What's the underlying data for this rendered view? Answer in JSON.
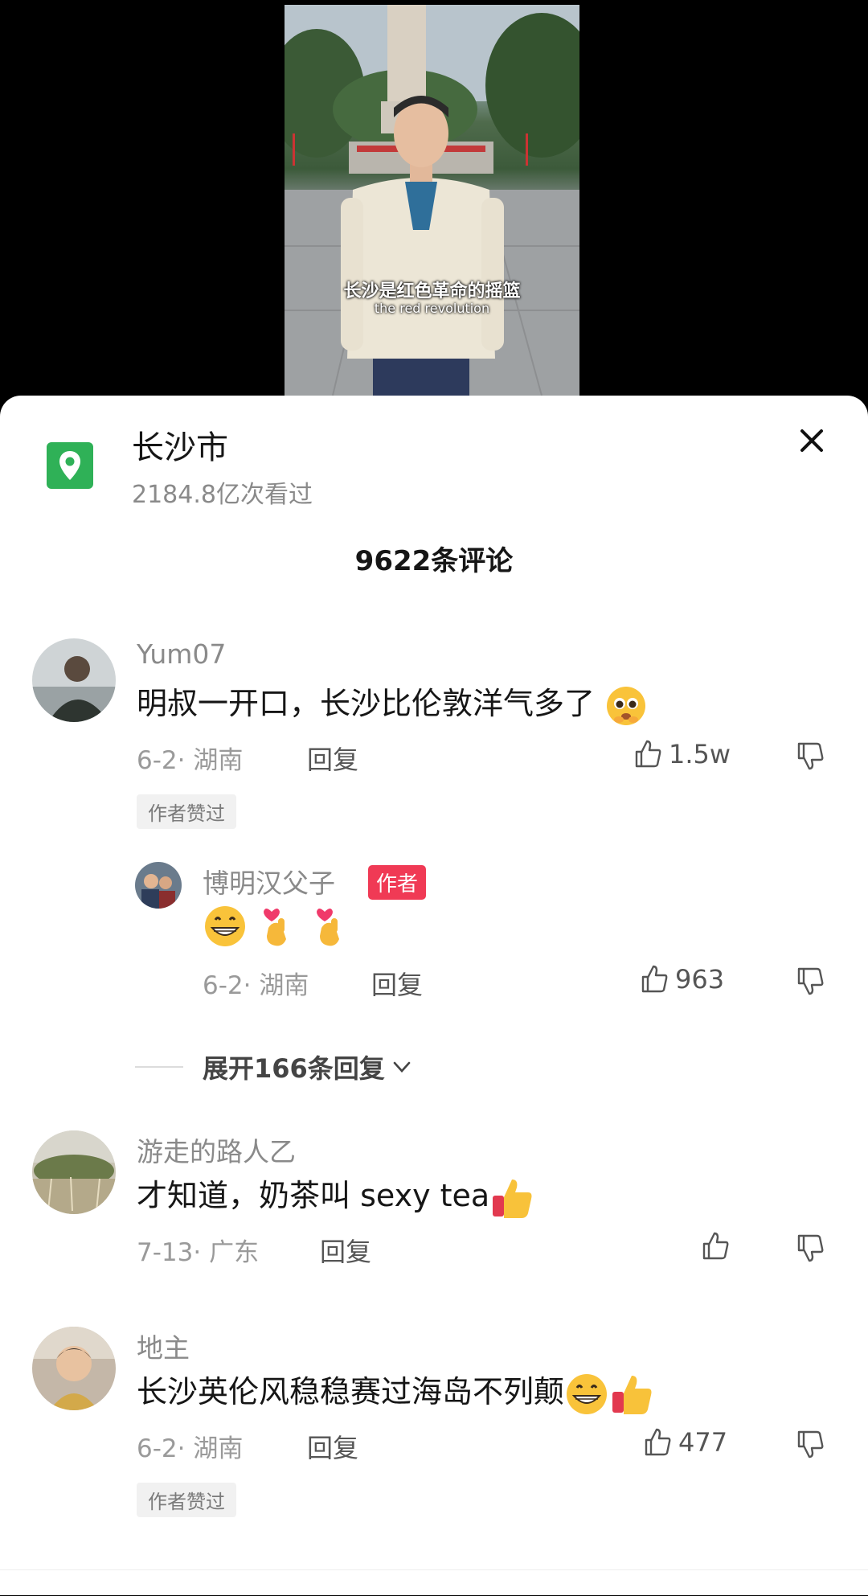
{
  "video": {
    "subtitle_cn": "长沙是红色革命的摇篮",
    "subtitle_en": "the red revolution"
  },
  "location": {
    "icon": "location-pin-icon",
    "title": "长沙市",
    "views": "2184.8亿次看过",
    "accent": "#2fb157"
  },
  "header": {
    "comments_count": "9622条评论",
    "close_icon": "close-icon"
  },
  "comments": [
    {
      "username": "Yum07",
      "text": "明叔一开口，长沙比伦敦洋气多了",
      "date": "6-2",
      "region": "湖南",
      "reply_label": "回复",
      "likes": "1.5w",
      "badge": "作者赞过",
      "emoji": [
        "pleading-face-emoji"
      ]
    },
    {
      "username": "博明汉父子",
      "author_badge": "作者",
      "text": "",
      "emoji": [
        "grin-face-emoji",
        "finger-heart-emoji",
        "finger-heart-emoji"
      ],
      "date": "6-2",
      "region": "湖南",
      "reply_label": "回复",
      "likes": "963"
    },
    {
      "username": "游走的路人乙",
      "text": "才知道，奶茶叫 sexy tea",
      "emoji": [
        "thumbs-up-emoji"
      ],
      "date": "7-13",
      "region": "广东",
      "reply_label": "回复",
      "likes": ""
    },
    {
      "username": "地主",
      "text": "长沙英伦风稳稳赛过海岛不列颠",
      "emoji": [
        "grin-face-emoji",
        "thumbs-up-emoji"
      ],
      "date": "6-2",
      "region": "湖南",
      "reply_label": "回复",
      "likes": "477",
      "badge": "作者赞过"
    }
  ],
  "expand_replies": "展开166条回复",
  "colors": {
    "author_badge": "#f03a55",
    "meta_gray": "#9a9a9a"
  }
}
